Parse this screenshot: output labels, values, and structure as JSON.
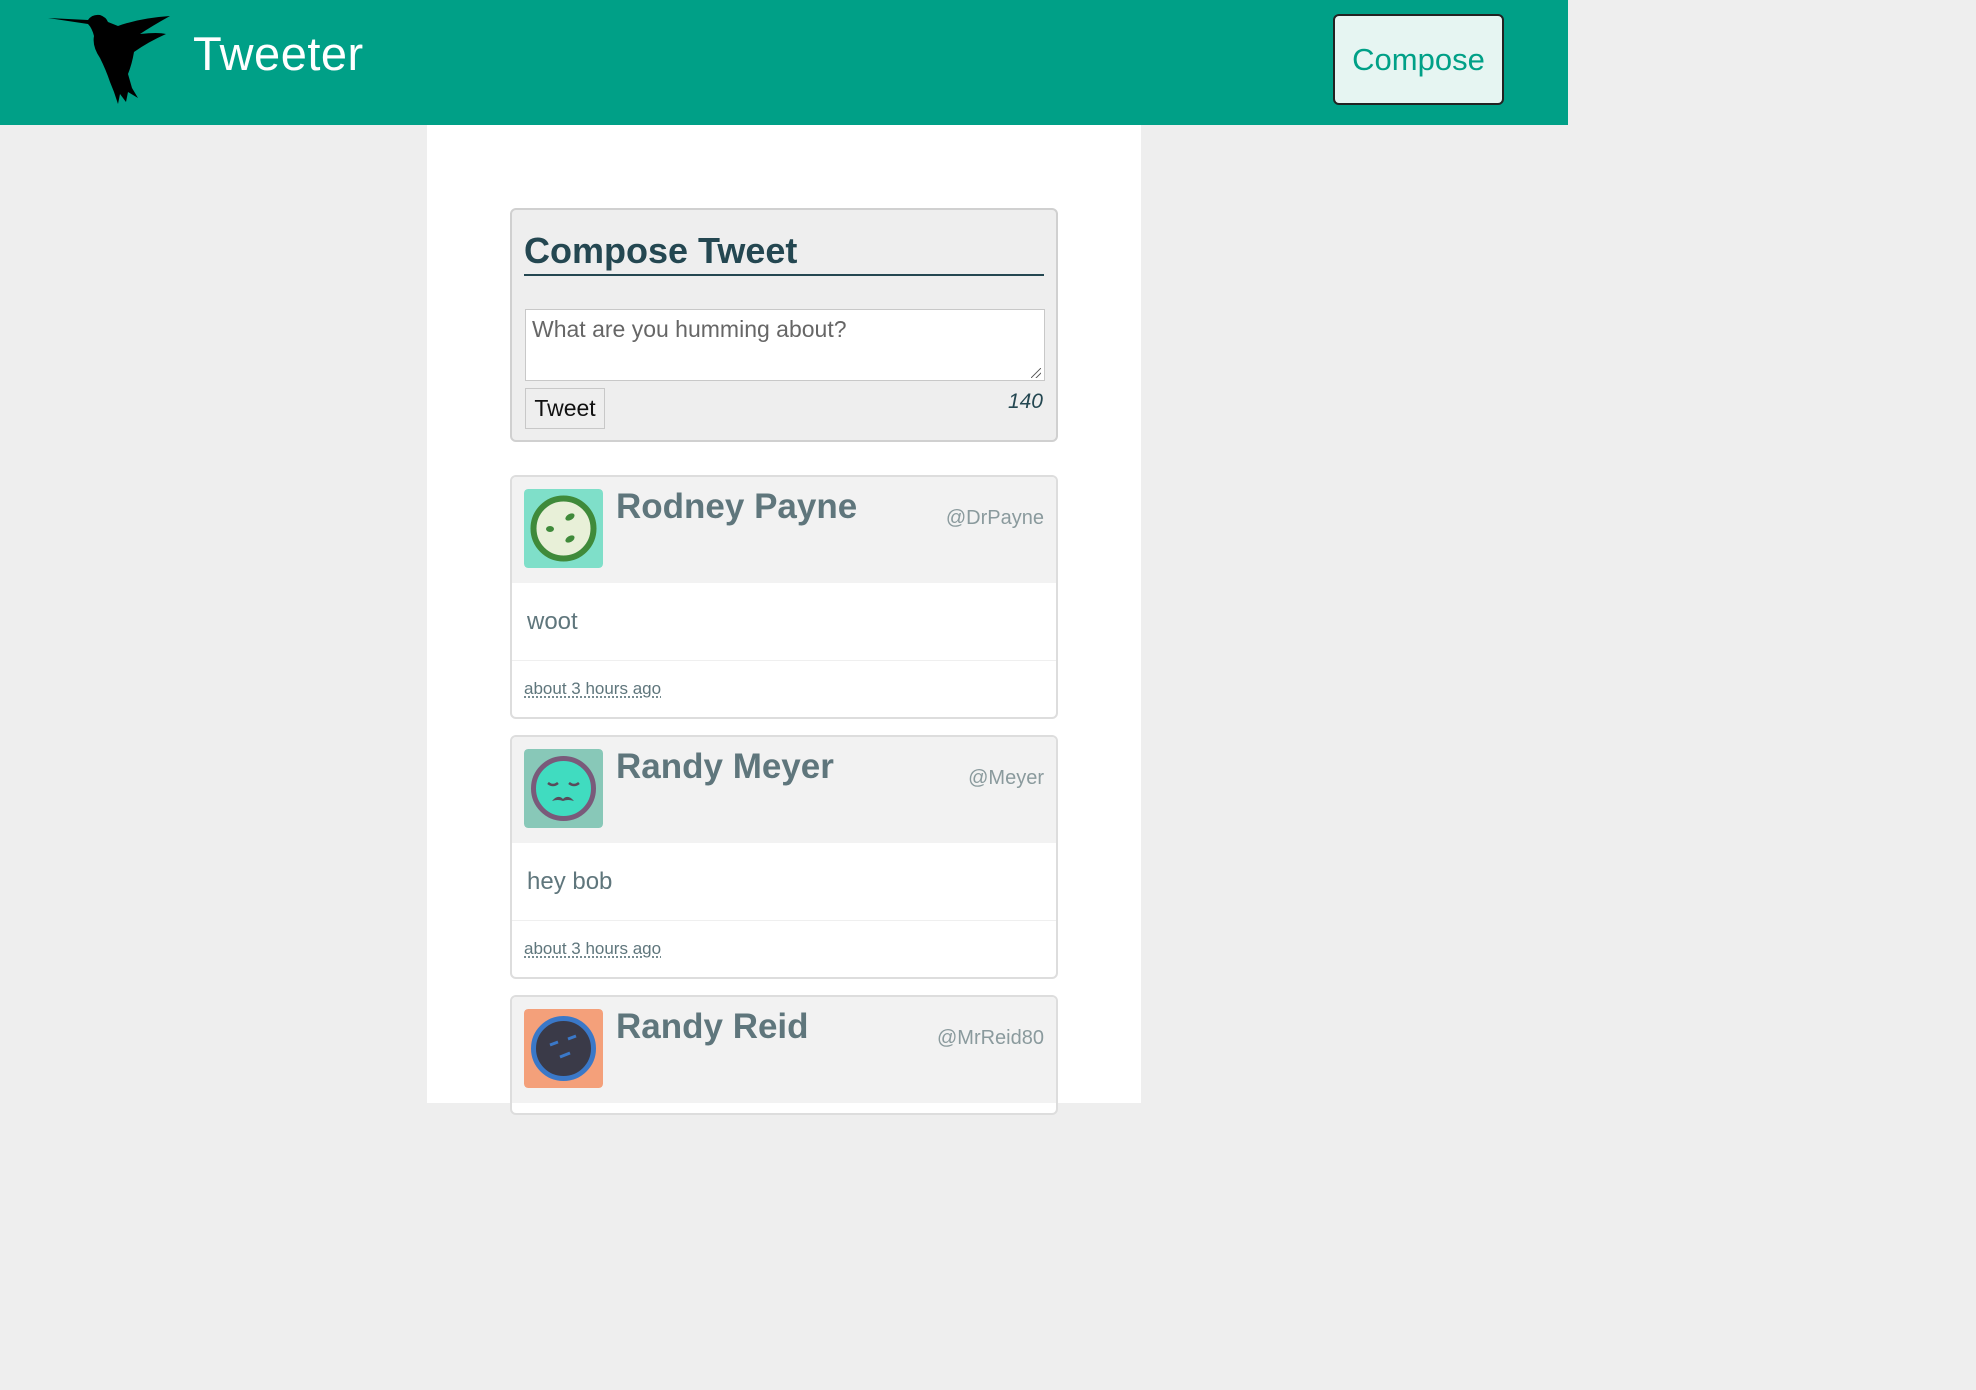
{
  "header": {
    "brand": "Tweeter",
    "logo_icon": "hummingbird-icon",
    "compose_label": "Compose"
  },
  "compose": {
    "title": "Compose Tweet",
    "placeholder": "What are you humming about?",
    "submit_label": "Tweet",
    "char_counter": "140"
  },
  "tweets": [
    {
      "name": "Rodney Payne",
      "handle": "@DrPayne",
      "content": "woot",
      "time": "about 3 hours ago",
      "avatar_bg": "#7fdfc9",
      "avatar_ring": "#3f8a3a",
      "avatar_face": "#e8f0d8"
    },
    {
      "name": "Randy Meyer",
      "handle": "@Meyer",
      "content": "hey bob",
      "time": "about 3 hours ago",
      "avatar_bg": "#88c8b8",
      "avatar_ring": "#7a5a7a",
      "avatar_face": "#40dcc0"
    },
    {
      "name": "Randy Reid",
      "handle": "@MrReid80",
      "avatar_bg": "#f4a07a",
      "avatar_ring": "#3a78c8",
      "avatar_face": "#3a3a48"
    }
  ],
  "colors": {
    "brand_green": "#00a087",
    "title_dark": "#244751",
    "tweet_text": "#5f767c"
  }
}
